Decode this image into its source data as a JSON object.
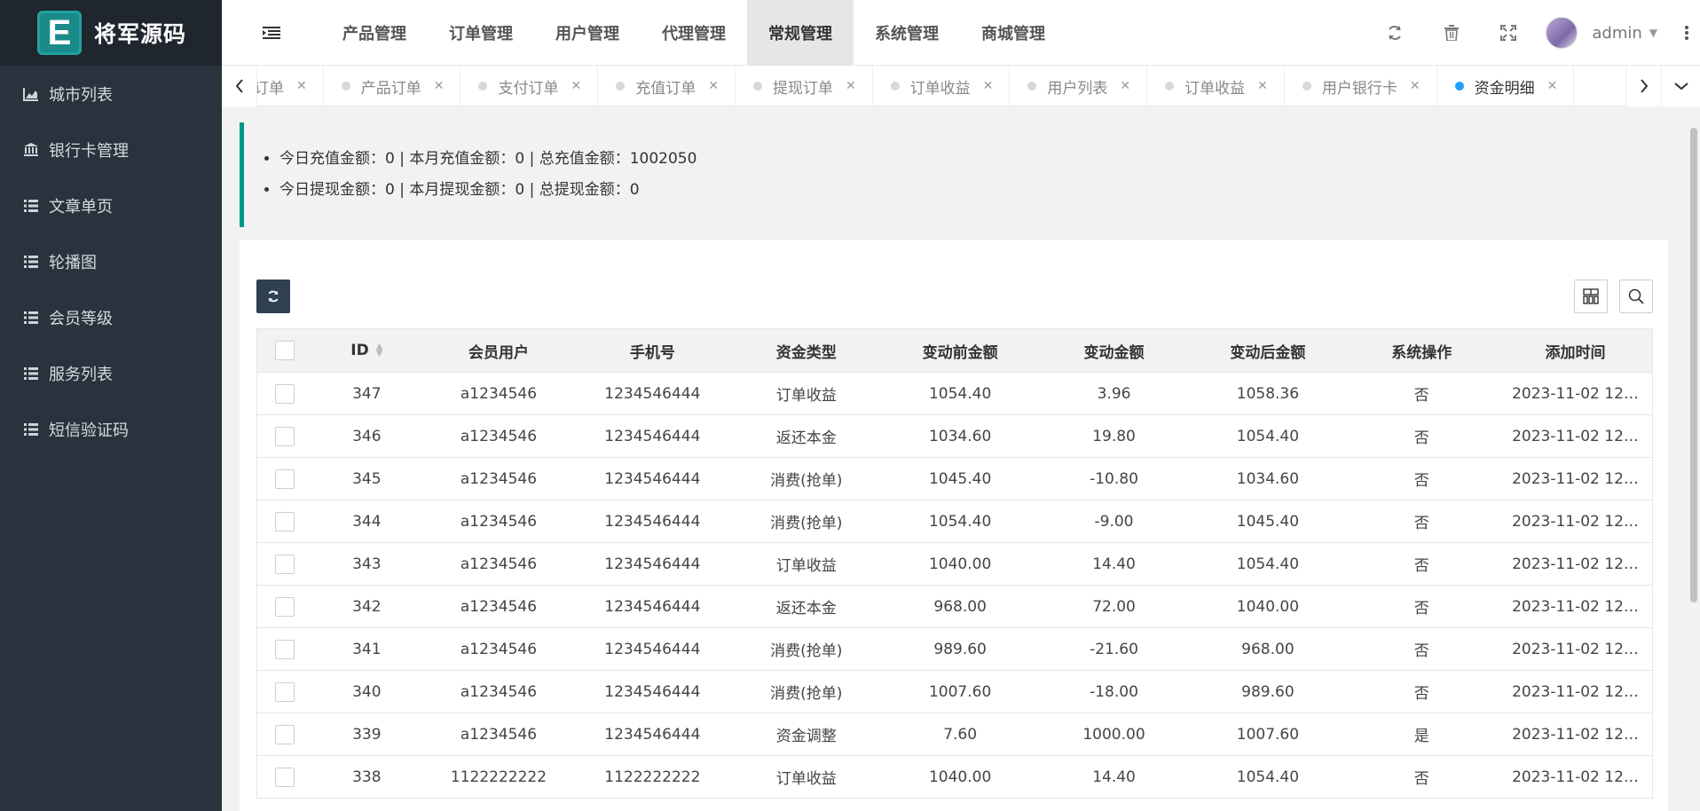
{
  "brand": {
    "logo_letter": "E",
    "name": "将军源码"
  },
  "sidebar": {
    "items": [
      {
        "label": "城市列表",
        "icon": "area-chart-icon"
      },
      {
        "label": "银行卡管理",
        "icon": "bank-icon"
      },
      {
        "label": "文章单页",
        "icon": "list-icon"
      },
      {
        "label": "轮播图",
        "icon": "list-icon"
      },
      {
        "label": "会员等级",
        "icon": "list-icon"
      },
      {
        "label": "服务列表",
        "icon": "list-icon"
      },
      {
        "label": "短信验证码",
        "icon": "list-icon"
      }
    ]
  },
  "topnav": {
    "items": [
      {
        "label": "产品管理"
      },
      {
        "label": "订单管理"
      },
      {
        "label": "用户管理"
      },
      {
        "label": "代理管理"
      },
      {
        "label": "常规管理",
        "active": true
      },
      {
        "label": "系统管理"
      },
      {
        "label": "商城管理"
      }
    ],
    "user": "admin"
  },
  "tabs": [
    {
      "label": "订单"
    },
    {
      "label": "产品订单"
    },
    {
      "label": "支付订单"
    },
    {
      "label": "充值订单"
    },
    {
      "label": "提现订单"
    },
    {
      "label": "订单收益"
    },
    {
      "label": "用户列表"
    },
    {
      "label": "订单收益"
    },
    {
      "label": "用户银行卡"
    },
    {
      "label": "资金明细",
      "active": true
    }
  ],
  "summary": {
    "line1": "今日充值金额：0 | 本月充值金额：0 | 总充值金额：1002050",
    "line2": "今日提现金额：0 | 本月提现金额：0 | 总提现金额：0"
  },
  "table": {
    "headers": [
      "ID",
      "会员用户",
      "手机号",
      "资金类型",
      "变动前金额",
      "变动金额",
      "变动后金额",
      "系统操作",
      "添加时间"
    ],
    "rows": [
      [
        "347",
        "a1234546",
        "1234546444",
        "订单收益",
        "1054.40",
        "3.96",
        "1058.36",
        "否",
        "2023-11-02 12…"
      ],
      [
        "346",
        "a1234546",
        "1234546444",
        "返还本金",
        "1034.60",
        "19.80",
        "1054.40",
        "否",
        "2023-11-02 12…"
      ],
      [
        "345",
        "a1234546",
        "1234546444",
        "消费(抢单)",
        "1045.40",
        "-10.80",
        "1034.60",
        "否",
        "2023-11-02 12…"
      ],
      [
        "344",
        "a1234546",
        "1234546444",
        "消费(抢单)",
        "1054.40",
        "-9.00",
        "1045.40",
        "否",
        "2023-11-02 12…"
      ],
      [
        "343",
        "a1234546",
        "1234546444",
        "订单收益",
        "1040.00",
        "14.40",
        "1054.40",
        "否",
        "2023-11-02 12…"
      ],
      [
        "342",
        "a1234546",
        "1234546444",
        "返还本金",
        "968.00",
        "72.00",
        "1040.00",
        "否",
        "2023-11-02 12…"
      ],
      [
        "341",
        "a1234546",
        "1234546444",
        "消费(抢单)",
        "989.60",
        "-21.60",
        "968.00",
        "否",
        "2023-11-02 12…"
      ],
      [
        "340",
        "a1234546",
        "1234546444",
        "消费(抢单)",
        "1007.60",
        "-18.00",
        "989.60",
        "否",
        "2023-11-02 12…"
      ],
      [
        "339",
        "a1234546",
        "1234546444",
        "资金调整",
        "7.60",
        "1000.00",
        "1007.60",
        "是",
        "2023-11-02 12…"
      ],
      [
        "338",
        "1122222222",
        "1122222222",
        "订单收益",
        "1040.00",
        "14.40",
        "1054.40",
        "否",
        "2023-11-02 12…"
      ]
    ]
  }
}
